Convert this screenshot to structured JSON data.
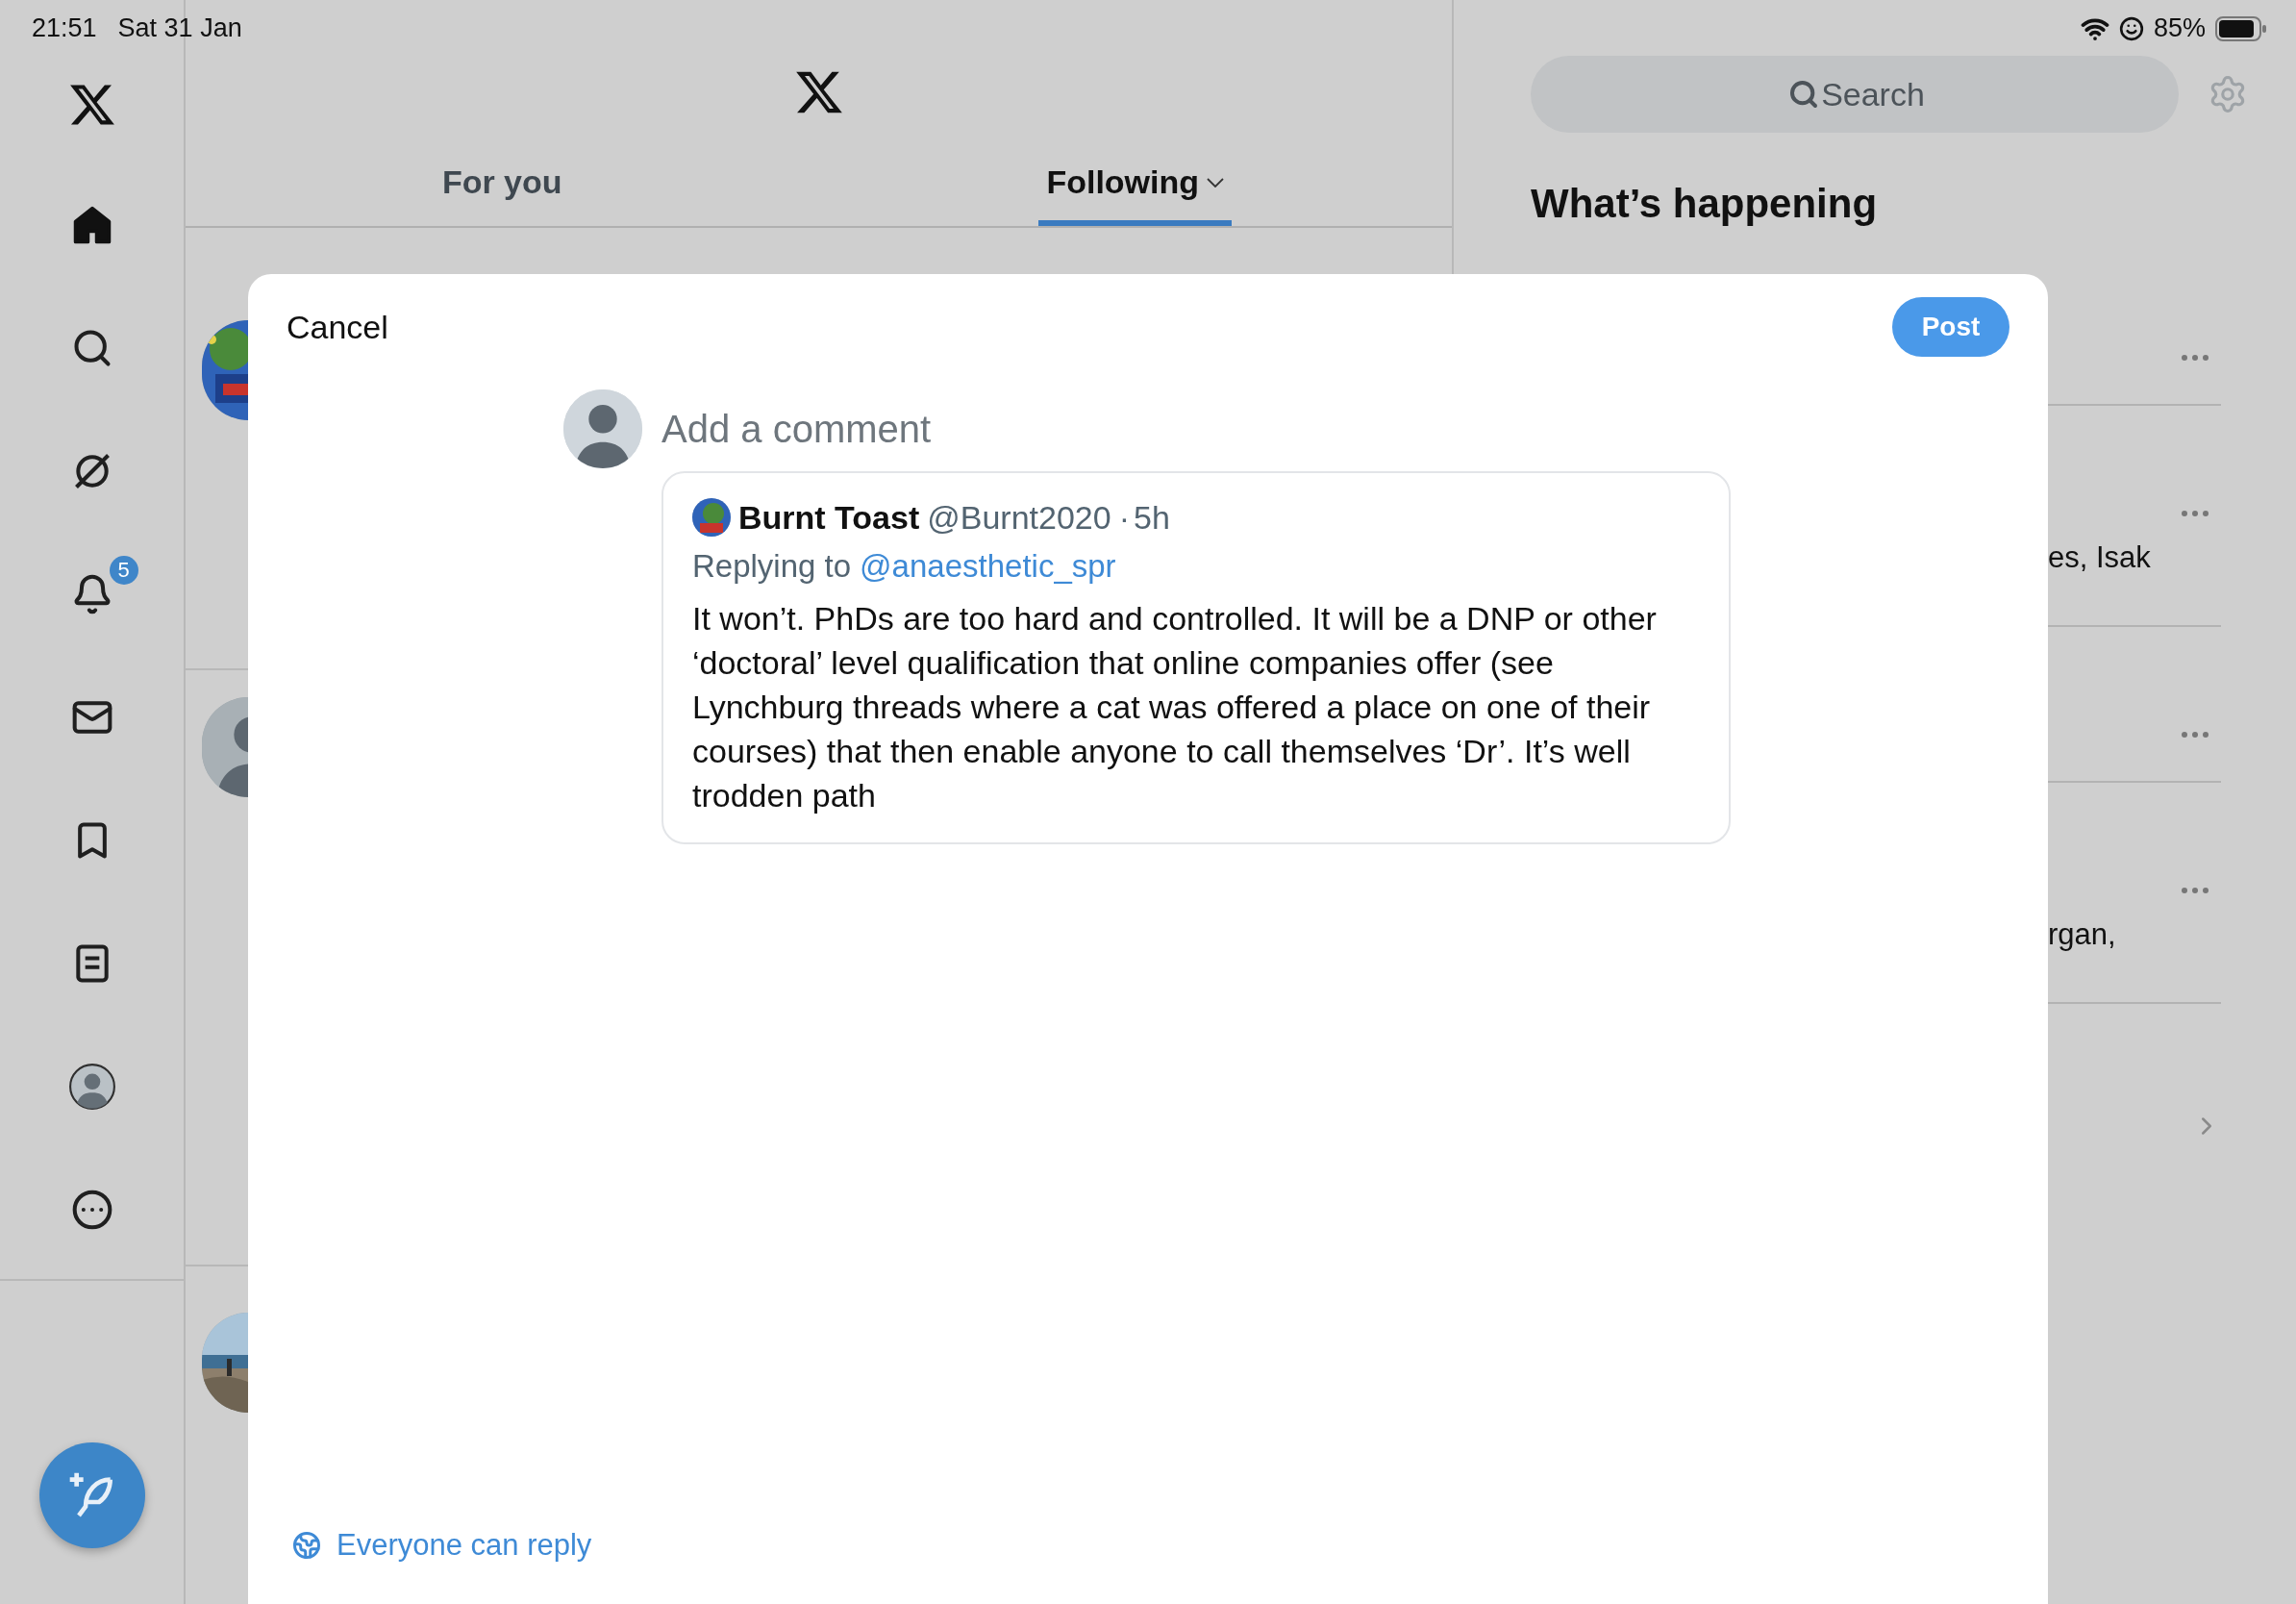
{
  "status_bar": {
    "time": "21:51",
    "date": "Sat 31 Jan",
    "battery": "85%"
  },
  "sidebar": {
    "items": [
      {
        "kind": "home",
        "selected": true
      },
      {
        "kind": "search",
        "selected": false
      },
      {
        "kind": "grok",
        "selected": false
      },
      {
        "kind": "notifications",
        "selected": false,
        "badge": "5"
      },
      {
        "kind": "messages",
        "selected": false
      },
      {
        "kind": "bookmarks",
        "selected": false
      },
      {
        "kind": "lists",
        "selected": false
      },
      {
        "kind": "profile",
        "selected": false
      },
      {
        "kind": "more",
        "selected": false
      }
    ]
  },
  "tabs": [
    {
      "label": "For you",
      "selected": false,
      "has_menu": false
    },
    {
      "label": "Following",
      "selected": true,
      "has_menu": true
    }
  ],
  "feed": [
    {
      "kind": "picture"
    },
    {
      "kind": "default"
    },
    {
      "kind": "picture"
    }
  ],
  "search": {
    "placeholder": "Search"
  },
  "trends": {
    "title": "What’s happening",
    "rows": [
      {
        "kind": "trend"
      },
      {
        "kind": "trend",
        "fragment": "es, Isak"
      },
      {
        "kind": "trend"
      },
      {
        "kind": "trend",
        "fragment": "rgan,"
      },
      {
        "kind": "more"
      }
    ]
  },
  "compose": {
    "cancel": "Cancel",
    "post": "Post",
    "placeholder": "Add a comment",
    "quote": {
      "name": "Burnt Toast",
      "handle": "@Burnt2020",
      "separator": "·",
      "time": "5h",
      "replying_label": "Replying to",
      "replying_to": "@anaesthetic_spr",
      "text": "It won’t. PhDs are too hard and controlled. It will be a DNP or other ‘doctoral’ level qualification that online companies offer (see Lynchburg threads where a cat was offered a place on one of their courses) that then enable anyone to call themselves ‘Dr’. It’s well trodden path"
    },
    "reply_setting": "Everyone can reply"
  }
}
